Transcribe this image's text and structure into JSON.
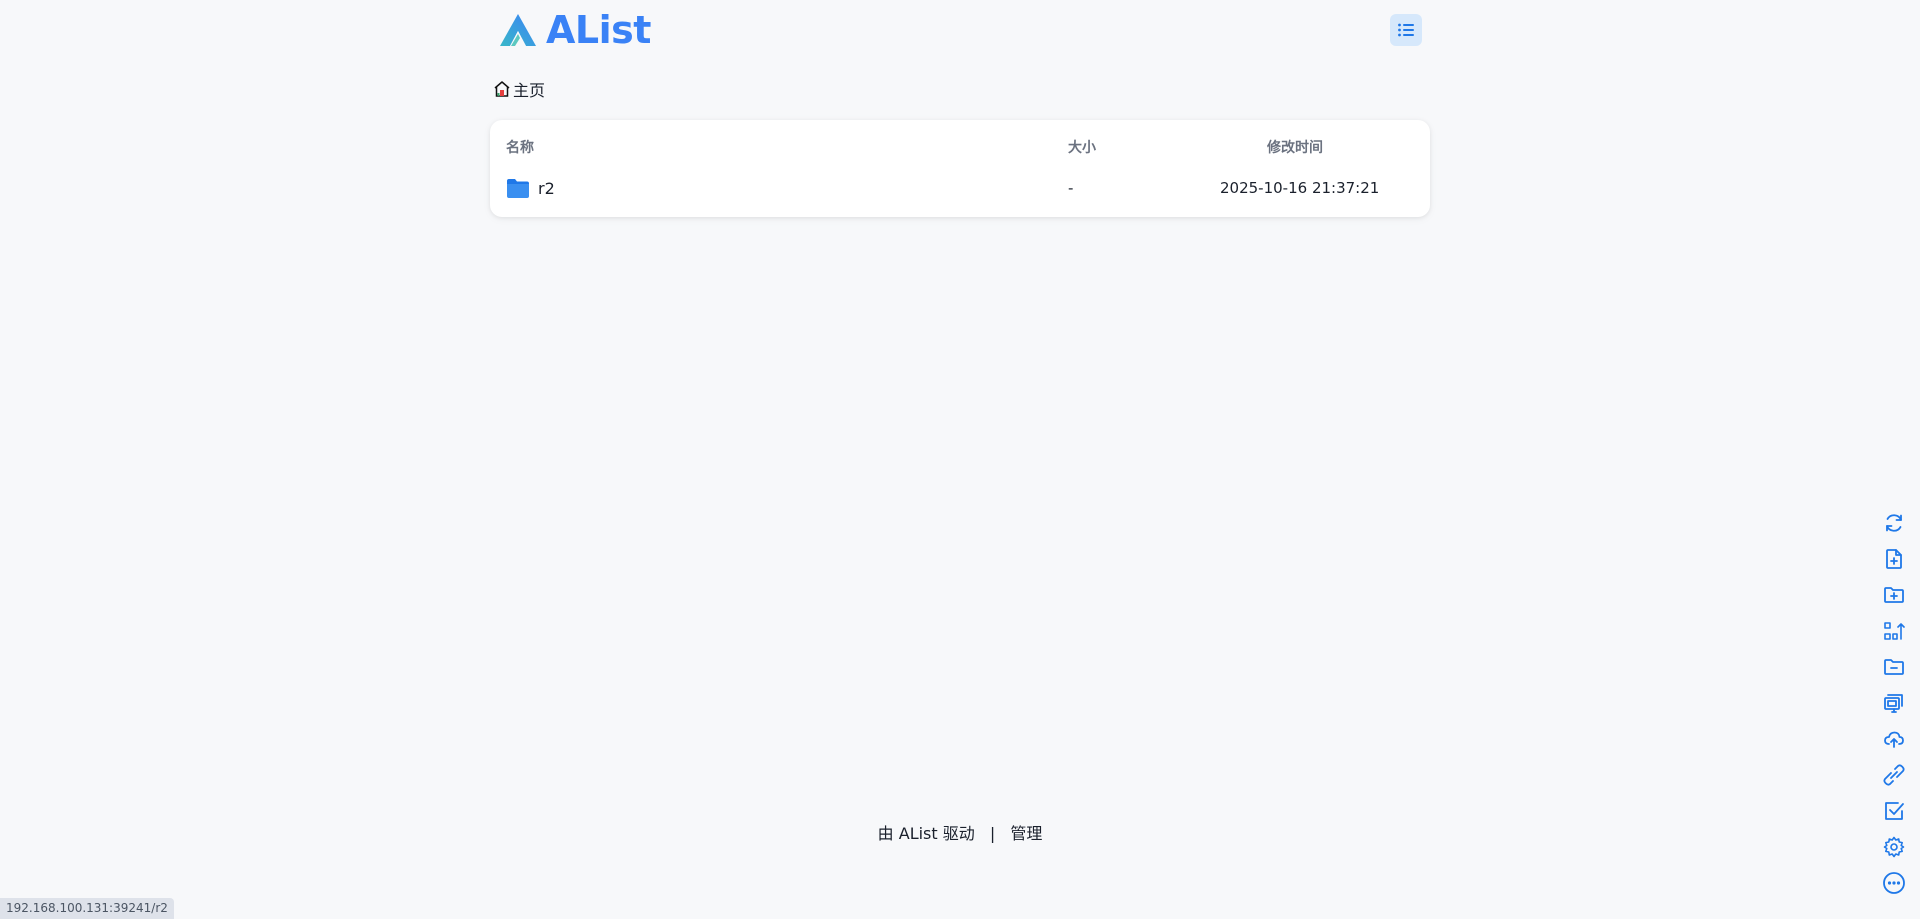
{
  "app": {
    "logo_text": "AList",
    "brand_color": "#3a82f6"
  },
  "header": {
    "layout_toggle_icon": "list-icon"
  },
  "breadcrumb": {
    "home_icon": "home-icon",
    "home_label": "主页"
  },
  "table": {
    "columns": [
      "名称",
      "大小",
      "修改时间"
    ],
    "rows": [
      {
        "icon": "folder-icon",
        "name": "r2",
        "size": "-",
        "modified": "2025-10-16 21:37:21"
      }
    ]
  },
  "footer": {
    "powered_by": "由 AList 驱动",
    "separator": "|",
    "manage_label": "管理"
  },
  "toolbar": {
    "items": [
      "refresh-icon",
      "new-file-icon",
      "new-folder-icon",
      "sort-icon",
      "folder-minus-icon",
      "copy-move-icon",
      "upload-cloud-icon",
      "link-icon",
      "checkbox-icon",
      "settings-icon",
      "more-icon"
    ]
  },
  "status_bar": {
    "url": "192.168.100.131:39241/r2"
  }
}
